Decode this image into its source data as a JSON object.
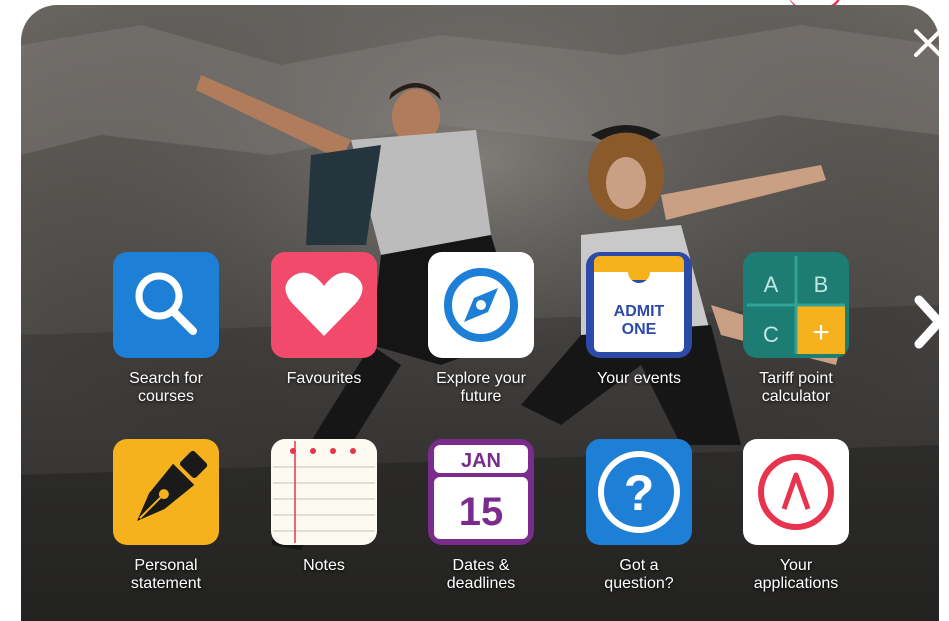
{
  "dialog": {
    "close_icon": "close-icon",
    "next_icon": "chevron-right-icon"
  },
  "tiles": [
    {
      "label": "Search for\ncourses",
      "icon": "search-icon",
      "color": "#1e7fd6"
    },
    {
      "label": "Favourites",
      "icon": "heart-icon",
      "color": "#f24a6b"
    },
    {
      "label": "Explore your\nfuture",
      "icon": "compass-icon",
      "color": "#1e7fd6"
    },
    {
      "label": "Your events",
      "icon": "ticket-icon",
      "color": "#2c4aa8",
      "icon_text_1": "ADMIT",
      "icon_text_2": "ONE"
    },
    {
      "label": "Tariff point\ncalculator",
      "icon": "calculator-icon",
      "color": "#1d7d74",
      "icon_text_a": "A",
      "icon_text_b": "B",
      "icon_text_c": "C",
      "icon_text_plus": "+"
    },
    {
      "label": "Personal\nstatement",
      "icon": "pen-nib-icon",
      "color": "#f5b21c"
    },
    {
      "label": "Notes",
      "icon": "notepad-icon",
      "color": "#e8334f"
    },
    {
      "label": "Dates &\ndeadlines",
      "icon": "calendar-icon",
      "color": "#7a2c8c",
      "icon_text_month": "JAN",
      "icon_text_day": "15"
    },
    {
      "label": "Got a\nquestion?",
      "icon": "question-icon",
      "color": "#1e7fd6",
      "icon_text_q": "?"
    },
    {
      "label": "Your\napplications",
      "icon": "ucas-logo-icon",
      "color": "#e8334f",
      "icon_text_caret": "Λ"
    }
  ]
}
